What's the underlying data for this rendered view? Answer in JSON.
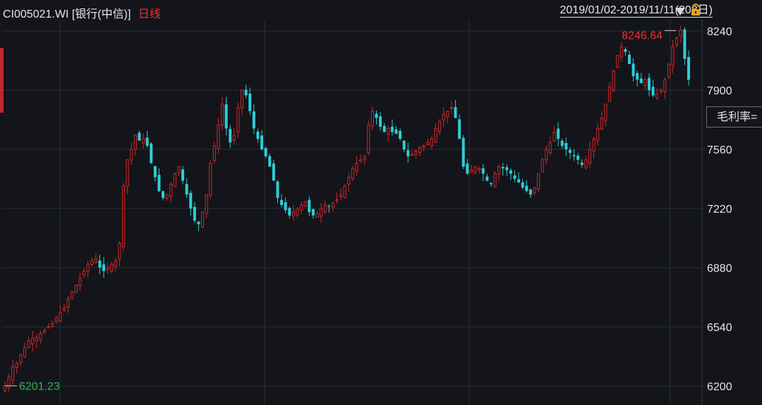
{
  "header": {
    "code": "CI005021.WI",
    "name": "[银行(中信)]",
    "period": "日线",
    "date_range": "2019/01/02-2019/11/11(208日)"
  },
  "indicator": {
    "label": "毛利率="
  },
  "colors": {
    "background": "#13151a",
    "up": "#d0262c",
    "down": "#2ecdd6",
    "grid": "#2a2e36",
    "max_label": "#e8333a",
    "min_label": "#2fb55c"
  },
  "chart_data": {
    "type": "candlestick",
    "title": "CI005021.WI [银行(中信)] 日线",
    "x_range": [
      "2019/01/02",
      "2019/11/11"
    ],
    "trading_days": 208,
    "y_ticks": [
      8240,
      7900,
      7560,
      7220,
      6880,
      6540,
      6200
    ],
    "ylim": [
      6160,
      8330
    ],
    "annotations": {
      "max": {
        "label": "8246.64",
        "value": 8246.64
      },
      "min": {
        "label": "6201.23",
        "value": 6201.23
      }
    },
    "close_path": [
      6201,
      6250,
      6310,
      6330,
      6380,
      6420,
      6460,
      6475,
      6480,
      6500,
      6520,
      6540,
      6560,
      6590,
      6620,
      6650,
      6700,
      6740,
      6780,
      6820,
      6860,
      6900,
      6920,
      6930,
      6880,
      6860,
      6880,
      6900,
      6920,
      7020,
      7350,
      7500,
      7560,
      7640,
      7610,
      7620,
      7580,
      7480,
      7400,
      7320,
      7280,
      7300,
      7360,
      7420,
      7460,
      7380,
      7300,
      7220,
      7150,
      7130,
      7200,
      7300,
      7480,
      7580,
      7700,
      7820,
      7680,
      7600,
      7640,
      7800,
      7900,
      7870,
      7780,
      7680,
      7620,
      7560,
      7520,
      7460,
      7380,
      7280,
      7240,
      7210,
      7180,
      7200,
      7220,
      7240,
      7260,
      7200,
      7180,
      7190,
      7220,
      7240,
      7230,
      7250,
      7270,
      7300,
      7350,
      7400,
      7450,
      7480,
      7500,
      7520,
      7700,
      7780,
      7740,
      7690,
      7660,
      7680,
      7660,
      7650,
      7620,
      7560,
      7520,
      7530,
      7550,
      7570,
      7580,
      7600,
      7620,
      7680,
      7720,
      7760,
      7780,
      7800,
      7740,
      7620,
      7460,
      7420,
      7440,
      7460,
      7450,
      7420,
      7380,
      7360,
      7420,
      7460,
      7450,
      7440,
      7420,
      7390,
      7370,
      7340,
      7320,
      7300,
      7340,
      7420,
      7500,
      7560,
      7600,
      7660,
      7620,
      7580,
      7560,
      7540,
      7520,
      7500,
      7470,
      7500,
      7560,
      7620,
      7680,
      7740,
      7820,
      7920,
      8010,
      8100,
      8150,
      8120,
      8050,
      7980,
      7960,
      7940,
      7960,
      7900,
      7870,
      7880,
      7900,
      7960,
      8050,
      8150,
      8200,
      8246,
      8080,
      7960
    ]
  }
}
